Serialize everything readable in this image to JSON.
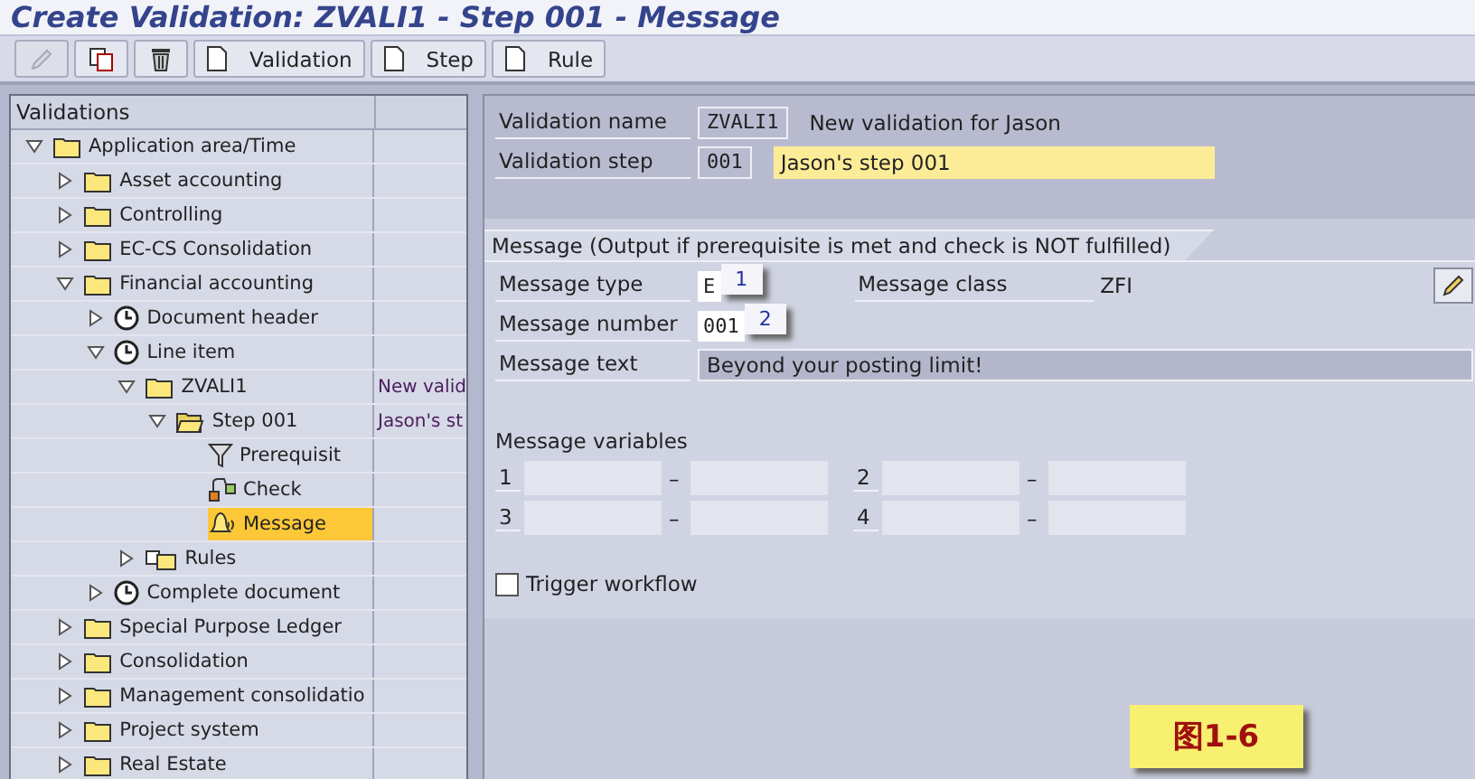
{
  "window": {
    "title": "Create Validation: ZVALI1 - Step 001 - Message"
  },
  "toolbar": {
    "buttons": [
      {
        "kind": "pencil",
        "disabled": true
      },
      {
        "kind": "copy",
        "disabled": false
      },
      {
        "kind": "trash",
        "disabled": false
      },
      {
        "kind": "new",
        "label": "Validation",
        "disabled": false
      },
      {
        "kind": "new",
        "label": "Step",
        "disabled": false
      },
      {
        "kind": "new",
        "label": "Rule",
        "disabled": false
      }
    ]
  },
  "tree": {
    "header": "Validations",
    "items": [
      {
        "label": "Application area/Time",
        "kind": "folder",
        "expanded": true,
        "selected": false,
        "children": [
          {
            "label": "Asset accounting",
            "kind": "folder",
            "expanded": false,
            "selected": false
          },
          {
            "label": "Controlling",
            "kind": "folder",
            "expanded": false,
            "selected": false
          },
          {
            "label": "EC-CS Consolidation",
            "kind": "folder",
            "expanded": false,
            "selected": false
          },
          {
            "label": "Financial accounting",
            "kind": "folder",
            "expanded": true,
            "selected": false,
            "children": [
              {
                "label": "Document header",
                "kind": "clock",
                "expanded": false,
                "selected": false
              },
              {
                "label": "Line item",
                "kind": "clock",
                "expanded": true,
                "selected": false,
                "children": [
                  {
                    "label": "ZVALI1",
                    "kind": "folder",
                    "expanded": true,
                    "selected": false,
                    "description": "New valid",
                    "children": [
                      {
                        "label": "Step 001",
                        "kind": "step",
                        "expanded": true,
                        "selected": false,
                        "description": "Jason's st",
                        "children": [
                          {
                            "label": "Prerequisit",
                            "kind": "prerequisite",
                            "selected": false
                          },
                          {
                            "label": "Check",
                            "kind": "check",
                            "selected": false
                          },
                          {
                            "label": "Message",
                            "kind": "message",
                            "selected": true
                          }
                        ]
                      }
                    ]
                  },
                  {
                    "label": "Rules",
                    "kind": "rules",
                    "expanded": false,
                    "selected": false
                  }
                ]
              },
              {
                "label": "Complete document",
                "kind": "clock",
                "expanded": false,
                "selected": false
              }
            ]
          },
          {
            "label": "Special Purpose Ledger",
            "kind": "folder",
            "expanded": false,
            "selected": false
          },
          {
            "label": "Consolidation",
            "kind": "folder",
            "expanded": false,
            "selected": false
          },
          {
            "label": "Management consolidatio",
            "kind": "folder",
            "expanded": false,
            "selected": false
          },
          {
            "label": "Project system",
            "kind": "folder",
            "expanded": false,
            "selected": false
          },
          {
            "label": "Real Estate",
            "kind": "folder",
            "expanded": false,
            "selected": false
          }
        ]
      }
    ]
  },
  "header_fields": [
    {
      "label": "Validation name",
      "value": "ZVALI1",
      "description": "New validation for Jason",
      "editable": false
    },
    {
      "label": "Validation step",
      "value": "001",
      "description": "Jason's step 001",
      "editable": true
    }
  ],
  "message_group": {
    "title": "Message (Output if prerequisite is met and check is NOT fulfilled)",
    "message_type": {
      "label": "Message type",
      "value": "E",
      "callout": "1"
    },
    "message_class": {
      "label": "Message class",
      "value": "ZFI"
    },
    "message_number": {
      "label": "Message number",
      "value": "001",
      "callout": "2"
    },
    "message_text": {
      "label": "Message text",
      "value": "Beyond your posting limit!"
    },
    "variables_label": "Message variables",
    "variables": [
      {
        "number": "1",
        "separator": "–"
      },
      {
        "number": "2",
        "separator": "–"
      },
      {
        "number": "3",
        "separator": "–"
      },
      {
        "number": "4",
        "separator": "–"
      }
    ],
    "trigger_workflow": {
      "label": "Trigger workflow",
      "checked": false
    }
  },
  "figure_label": "图1-6"
}
